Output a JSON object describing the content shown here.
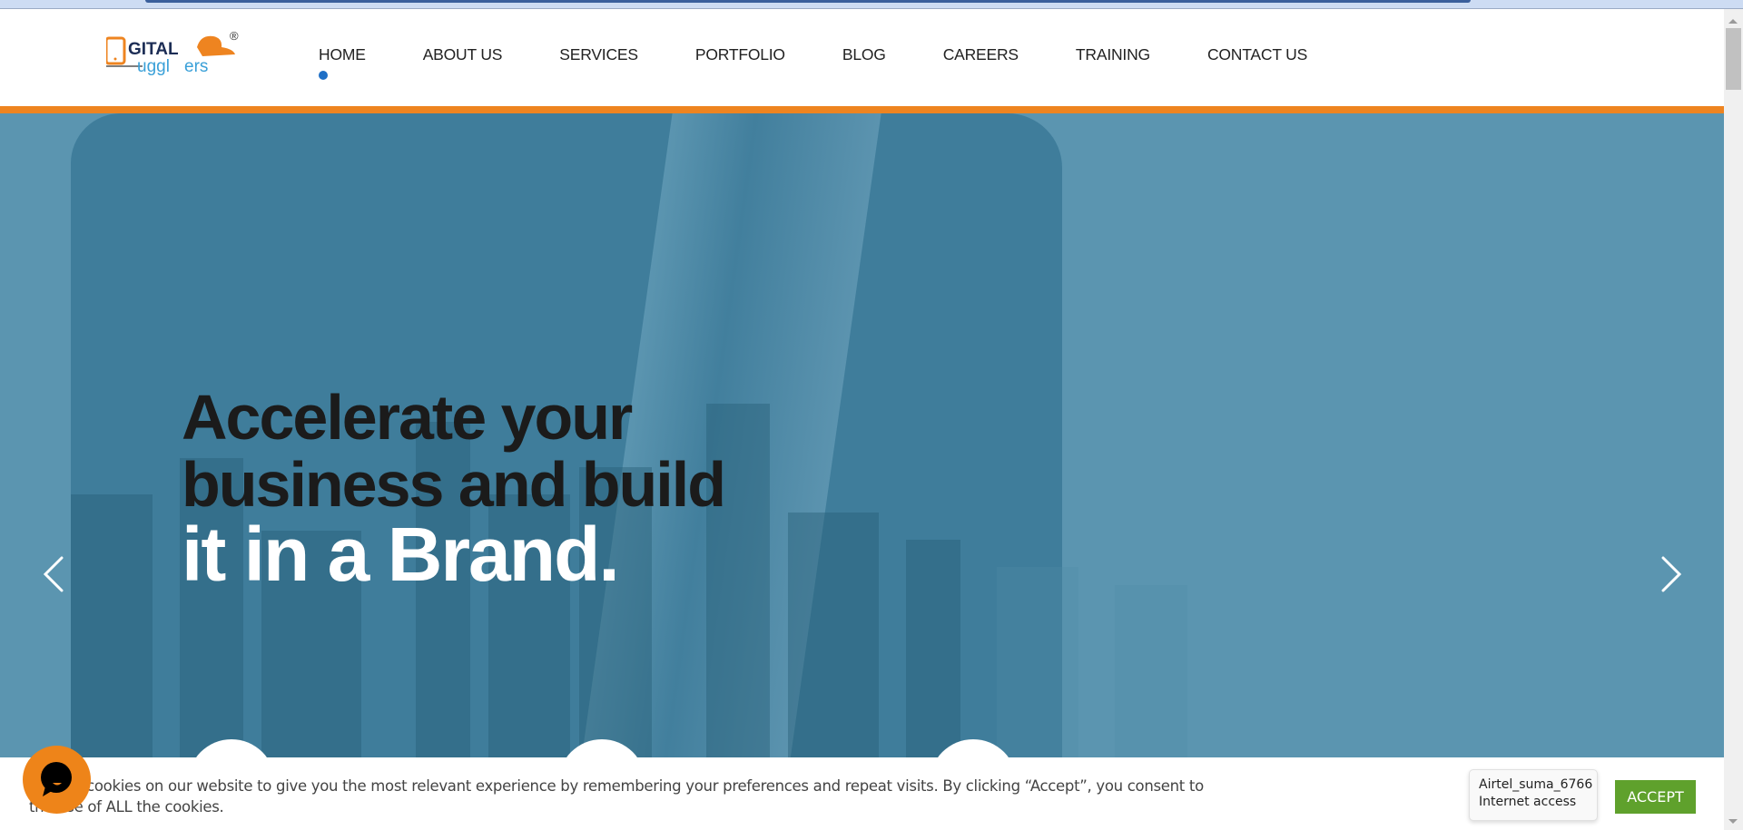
{
  "browser": {
    "top_strip": ""
  },
  "header": {
    "logo_text": {
      "part1": "GITAL",
      "part2": "uggl",
      "part3": "ers",
      "registered": "®"
    },
    "nav": [
      {
        "label": "HOME",
        "active": true
      },
      {
        "label": "ABOUT US",
        "active": false
      },
      {
        "label": "SERVICES",
        "active": false
      },
      {
        "label": "PORTFOLIO",
        "active": false
      },
      {
        "label": "BLOG",
        "active": false
      },
      {
        "label": "CAREERS",
        "active": false
      },
      {
        "label": "TRAINING",
        "active": false
      },
      {
        "label": "CONTACT US",
        "active": false
      }
    ]
  },
  "hero": {
    "line1": "Accelerate your",
    "line2": "business and build",
    "line3": "it in a Brand.",
    "prev_icon": "chevron-left-icon",
    "next_icon": "chevron-right-icon"
  },
  "cookie": {
    "text": "We use cookies on our website to give you the most relevant experience by remembering your preferences and repeat visits. By clicking “Accept”, you consent to the use of ALL the cookies.",
    "accept_label": "ACCEPT"
  },
  "tooltip": {
    "line1": "Airtel_suma_6766",
    "line2": "Internet access"
  },
  "colors": {
    "accent_orange": "#ee8420",
    "nav_active_dot": "#1e6fc6",
    "hero_bg": "#5b95b0",
    "accept_green": "#5fa12c"
  }
}
